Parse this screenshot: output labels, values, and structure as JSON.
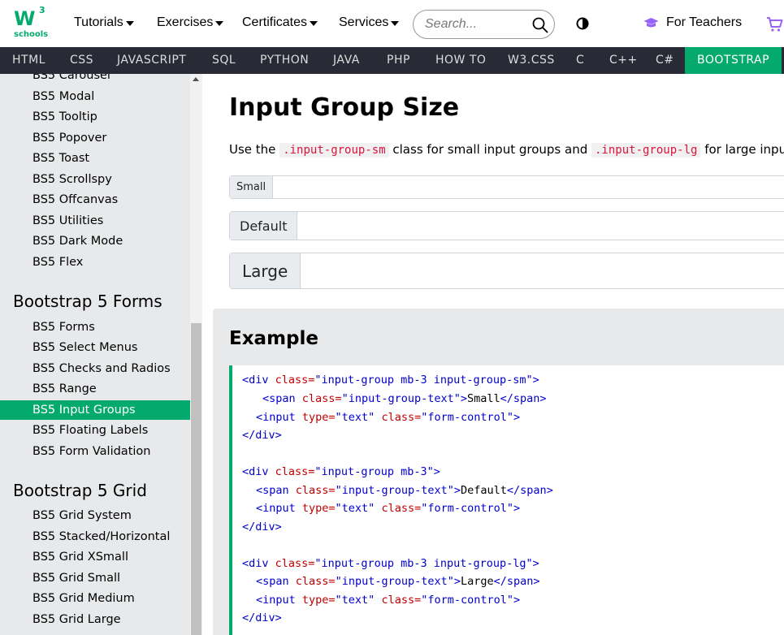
{
  "logo": {
    "brand": "W",
    "sup": "3",
    "sub": "schools"
  },
  "topnav": [
    {
      "label": "Tutorials"
    },
    {
      "label": "Exercises"
    },
    {
      "label": "Certificates"
    },
    {
      "label": "Services"
    }
  ],
  "search": {
    "placeholder": "Search..."
  },
  "teachers_label": "For Teachers",
  "subjects": [
    "HTML",
    "CSS",
    "JAVASCRIPT",
    "SQL",
    "PYTHON",
    "JAVA",
    "PHP",
    "HOW TO",
    "W3.CSS",
    "C",
    "C++",
    "C#",
    "BOOTSTRAP"
  ],
  "sidebar": {
    "group1": [
      "BS5 Carousel",
      "BS5 Modal",
      "BS5 Tooltip",
      "BS5 Popover",
      "BS5 Toast",
      "BS5 Scrollspy",
      "BS5 Offcanvas",
      "BS5 Utilities",
      "BS5 Dark Mode",
      "BS5 Flex"
    ],
    "head_forms": "Bootstrap 5 Forms",
    "forms": [
      "BS5 Forms",
      "BS5 Select Menus",
      "BS5 Checks and Radios",
      "BS5 Range",
      "BS5 Input Groups",
      "BS5 Floating Labels",
      "BS5 Form Validation"
    ],
    "head_grid": "Bootstrap 5 Grid",
    "grid": [
      "BS5 Grid System",
      "BS5 Stacked/Horizontal",
      "BS5 Grid XSmall",
      "BS5 Grid Small",
      "BS5 Grid Medium",
      "BS5 Grid Large"
    ]
  },
  "main": {
    "title": "Input Group Size",
    "intro_pre": "Use the ",
    "code1": ".input-group-sm",
    "intro_mid": " class for small input groups and ",
    "code2": ".input-group-lg",
    "intro_post": " for large input groups:",
    "demo": {
      "small": "Small",
      "default": "Default",
      "large": "Large"
    },
    "example_title": "Example",
    "code": {
      "l1": [
        "<div ",
        "class=",
        "\"input-group mb-3 input-group-sm\"",
        ">"
      ],
      "l2": [
        "<span ",
        "class=",
        "\"input-group-text\"",
        ">",
        "Small",
        "</span>"
      ],
      "l3": [
        "<input ",
        "type=",
        "\"text\" ",
        "class=",
        "\"form-control\"",
        ">"
      ],
      "l4": "</div>",
      "l5": [
        "<div ",
        "class=",
        "\"input-group mb-3\"",
        ">"
      ],
      "l6": [
        "<span ",
        "class=",
        "\"input-group-text\"",
        ">",
        "Default",
        "</span>"
      ],
      "l7": [
        "<input ",
        "type=",
        "\"text\" ",
        "class=",
        "\"form-control\"",
        ">"
      ],
      "l8": "</div>",
      "l9": [
        "<div ",
        "class=",
        "\"input-group mb-3 input-group-lg\"",
        ">"
      ],
      "l10": [
        "<span ",
        "class=",
        "\"input-group-text\"",
        ">",
        "Large",
        "</span>"
      ],
      "l11": [
        "<input ",
        "type=",
        "\"text\" ",
        "class=",
        "\"form-control\"",
        ">"
      ],
      "l12": "</div>"
    }
  }
}
